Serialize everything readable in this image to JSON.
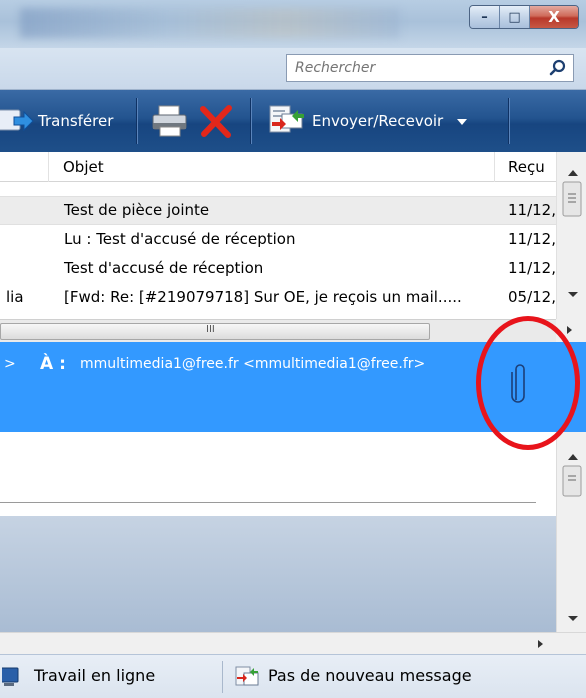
{
  "window": {
    "minimize_label": "–",
    "maximize_label": "□",
    "close_label": "X"
  },
  "search": {
    "placeholder": "Rechercher"
  },
  "toolbar": {
    "forward_label": "Transférer",
    "send_receive_label": "Envoyer/Recevoir"
  },
  "list": {
    "columns": {
      "subject": "Objet",
      "received": "Reçu"
    },
    "rows": [
      {
        "from": "",
        "subject": "Test de pièce jointe",
        "received": "11/12,",
        "selected": true
      },
      {
        "from": "",
        "subject": "Lu : Test d'accusé de réception",
        "received": "11/12,"
      },
      {
        "from": "",
        "subject": "Test d'accusé de réception",
        "received": "11/12,"
      },
      {
        "from": "lia",
        "subject": "[Fwd: Re: [#219079718] Sur OE, je reçois un mail.....",
        "received": "05/12,"
      }
    ],
    "hscroll_grip": "III"
  },
  "preview": {
    "from_arrow": ">",
    "to_label": "À :",
    "to_value": "mmultimedia1@free.fr <mmultimedia1@free.fr>"
  },
  "statusbar": {
    "online_label": "Travail en ligne",
    "no_new_label": "Pas de nouveau message"
  },
  "colors": {
    "toolbar": "#1e4f89",
    "selection": "#3399ff",
    "highlight_circle": "#e8141b"
  },
  "icons": [
    "search-icon",
    "forward-icon",
    "print-icon",
    "delete-icon",
    "send-receive-icon",
    "paperclip-icon",
    "online-icon",
    "no-new-message-icon"
  ]
}
